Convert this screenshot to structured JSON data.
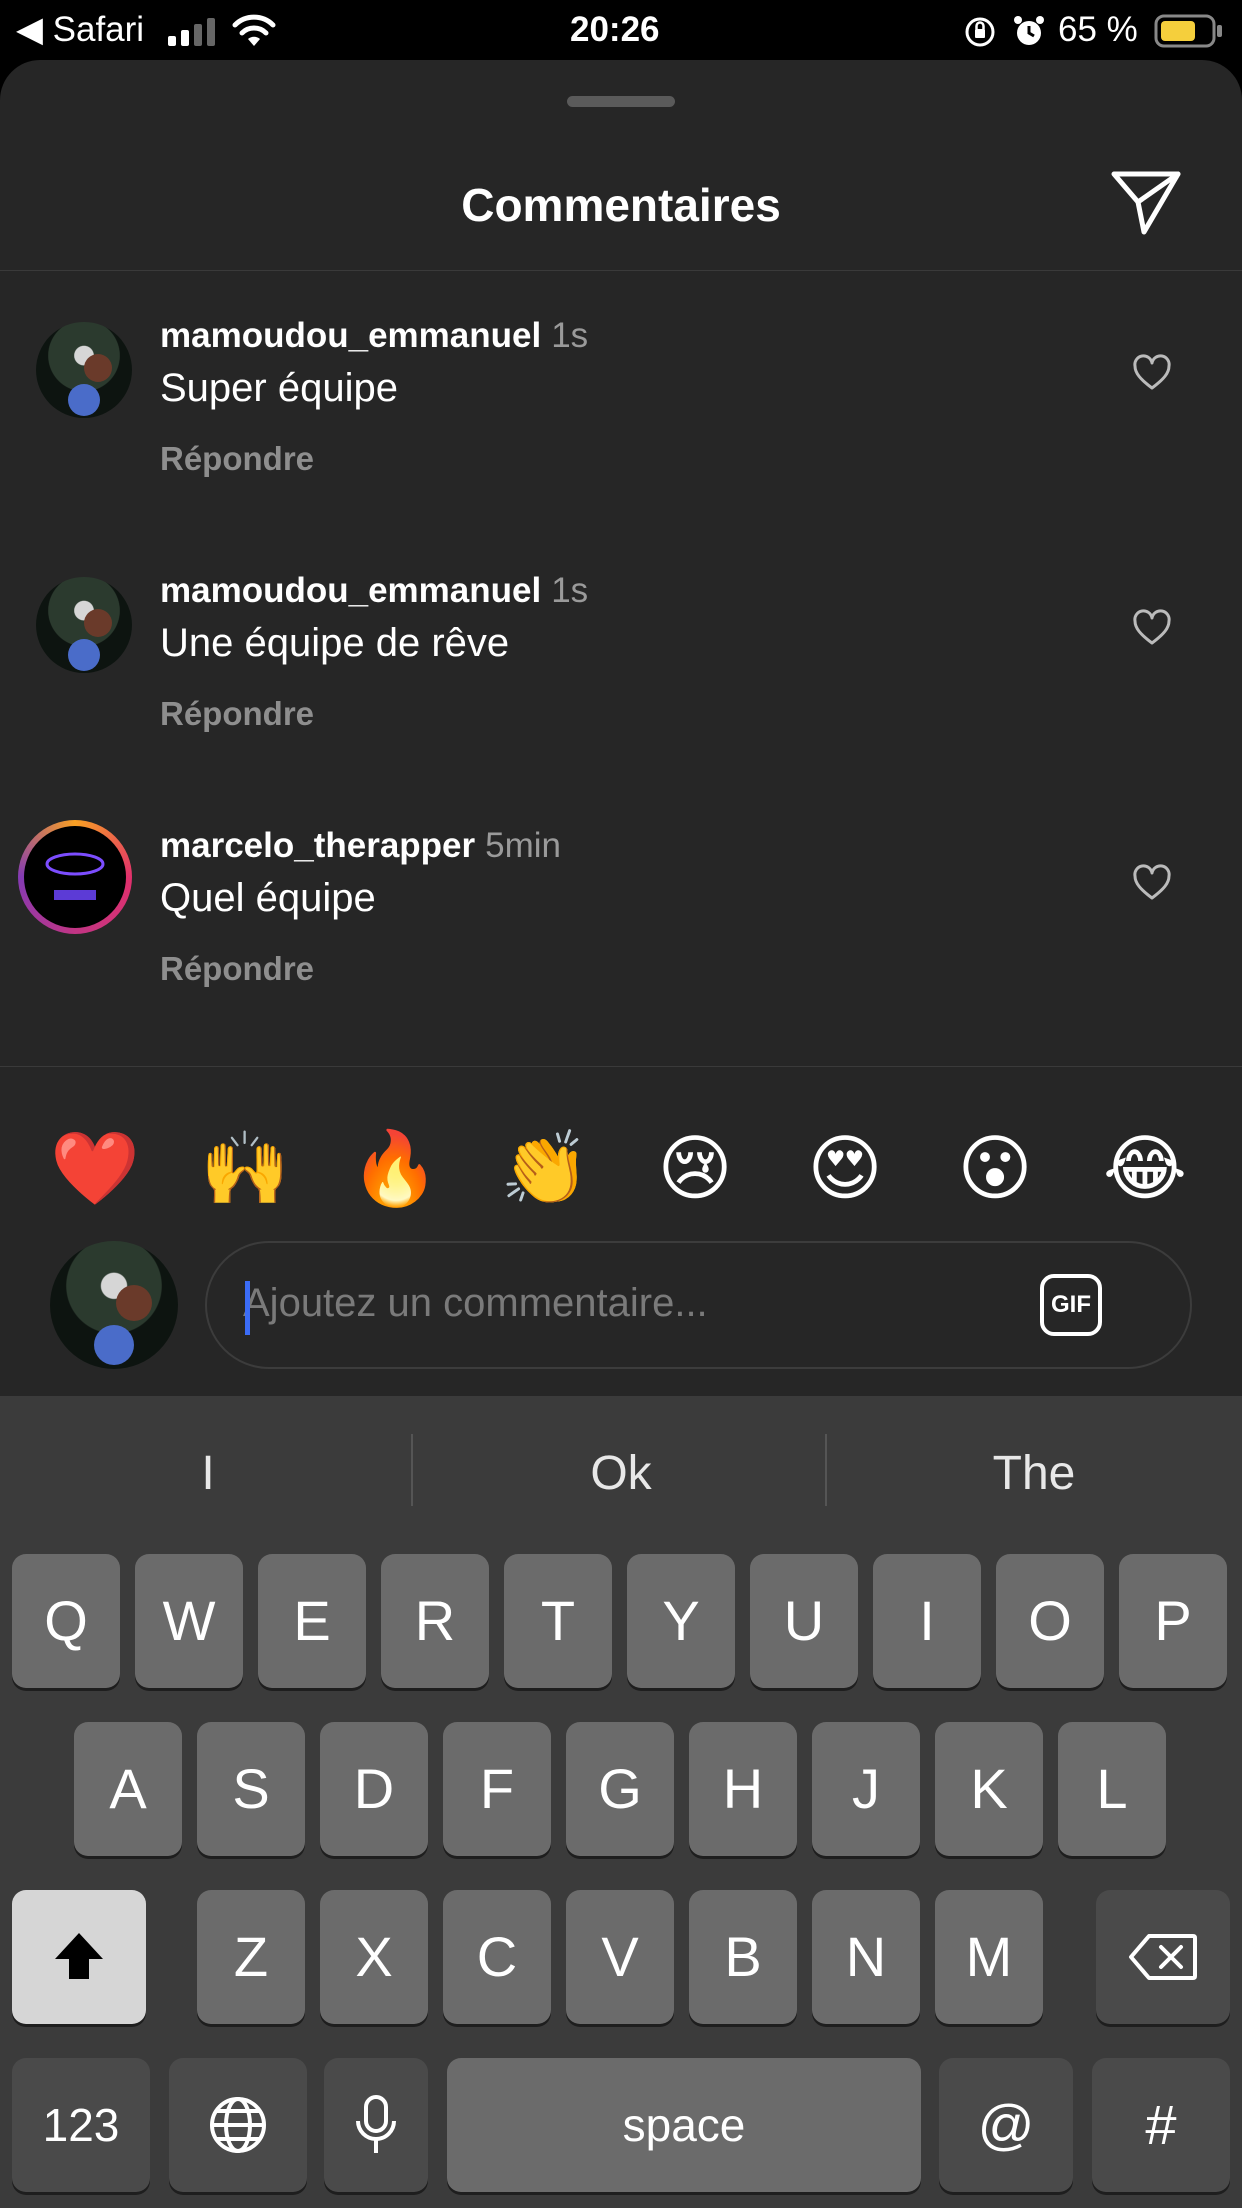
{
  "status_bar": {
    "back_app": "◀ Safari",
    "time": "20:26",
    "battery": "65 %"
  },
  "sheet": {
    "title": "Commentaires"
  },
  "comments": [
    {
      "username": "mamoudou_emmanuel",
      "time": "1s",
      "text": "Super équipe",
      "reply": "Répondre"
    },
    {
      "username": "mamoudou_emmanuel",
      "time": "1s",
      "text": "Une équipe de rêve",
      "reply": "Répondre"
    },
    {
      "username": "marcelo_therapper",
      "time": "5min",
      "text": "Quel équipe",
      "reply": "Répondre"
    }
  ],
  "emoji_bar": [
    "❤️",
    "🙌",
    "🔥",
    "👏",
    "😢",
    "😍",
    "😮",
    "😂"
  ],
  "composer": {
    "placeholder": "Ajoutez un commentaire...",
    "gif_label": "GIF"
  },
  "keyboard": {
    "suggestions": [
      "I",
      "Ok",
      "The"
    ],
    "row1": [
      "Q",
      "W",
      "E",
      "R",
      "T",
      "Y",
      "U",
      "I",
      "O",
      "P"
    ],
    "row2": [
      "A",
      "S",
      "D",
      "F",
      "G",
      "H",
      "J",
      "K",
      "L"
    ],
    "row3": [
      "Z",
      "X",
      "C",
      "V",
      "B",
      "N",
      "M"
    ],
    "numbers_label": "123",
    "space_label": "space",
    "at_label": "@",
    "hash_label": "#"
  },
  "colors": {
    "background": "#262626",
    "keyboard": "#3b3b3b",
    "accent_caret": "#3b6cf6",
    "story_ring": "#e1306c"
  }
}
